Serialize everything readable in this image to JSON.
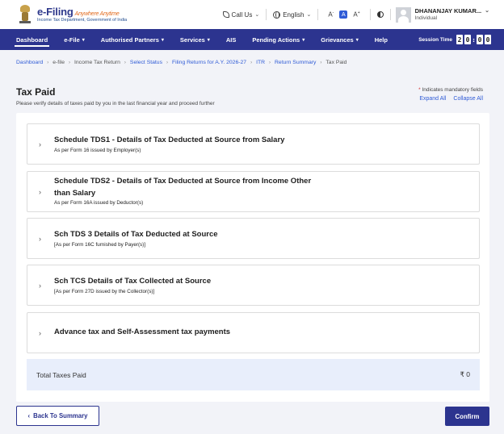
{
  "header": {
    "logo_main": "e-Filing",
    "logo_tag": "Anywhere Anytime",
    "logo_sub": "Income Tax Department, Government of India",
    "call_us": "Call Us",
    "language": "English",
    "font_smaller": "A",
    "font_normal": "A",
    "font_larger": "A",
    "user_name": "DHANANJAY KUMAR...",
    "user_role": "Individual"
  },
  "nav": {
    "items": [
      {
        "label": "Dashboard"
      },
      {
        "label": "e-File"
      },
      {
        "label": "Authorised Partners"
      },
      {
        "label": "Services"
      },
      {
        "label": "AIS"
      },
      {
        "label": "Pending Actions"
      },
      {
        "label": "Grievances"
      },
      {
        "label": "Help"
      }
    ],
    "session_label": "Session Time",
    "timer": [
      "2",
      "0",
      "0",
      "0"
    ]
  },
  "breadcrumb": [
    {
      "label": "Dashboard"
    },
    {
      "label": "e-file"
    },
    {
      "label": "Income Tax Return"
    },
    {
      "label": "Select Status"
    },
    {
      "label": "Filing Returns for A.Y. 2026-27"
    },
    {
      "label": "ITR"
    },
    {
      "label": "Return Summary"
    },
    {
      "label": "Tax Paid"
    }
  ],
  "page": {
    "title": "Tax Paid",
    "subtitle": "Please verify details of taxes paid by you in the last financial year and proceed further",
    "mandatory_note": "Indicates mandatory fields",
    "expand_all": "Expand All",
    "collapse_all": "Collapse All"
  },
  "sections": [
    {
      "title": "Schedule TDS1 - Details of Tax Deducted at Source from Salary",
      "sub": "As per Form 16 issued by Employer(s)"
    },
    {
      "title_line1": "Schedule TDS2 - Details of Tax Deducted at Source from Income Other",
      "title_line2": "than Salary",
      "sub": "As per Form 16A issued by Deductor(s)"
    },
    {
      "title": "Sch TDS 3 Details of Tax Deducted at Source",
      "sub": "[As per Form 16C furnished by Payer(s)]"
    },
    {
      "title": "Sch TCS Details of Tax Collected at Source",
      "sub": "[As per Form 27D issued by the Collector(s)]"
    },
    {
      "title": "Advance tax and Self-Assessment tax payments"
    }
  ],
  "total": {
    "label": "Total Taxes Paid",
    "value": "₹ 0"
  },
  "footer": {
    "back_label": "Back To Summary",
    "confirm_label": "Confirm"
  },
  "colors": {
    "nav_bg": "#2c348f",
    "link": "#2f5bd6",
    "total_bg": "#e8eefb"
  }
}
